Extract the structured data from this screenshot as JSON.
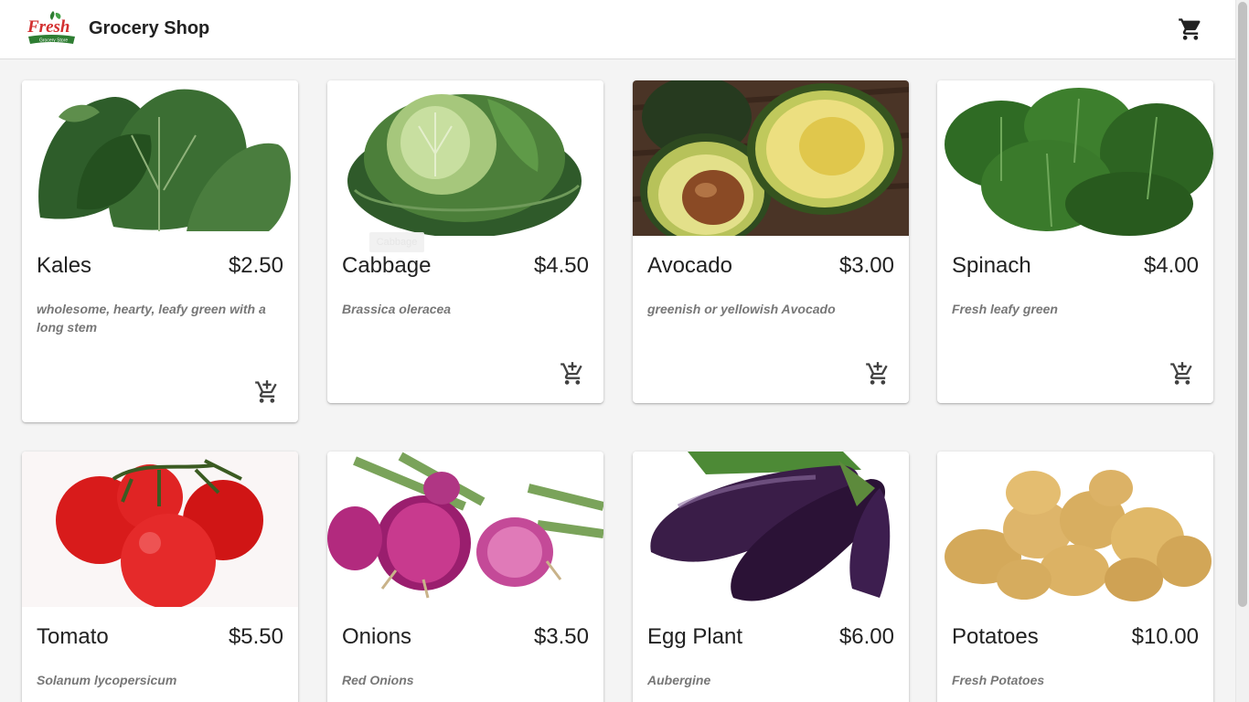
{
  "header": {
    "logo_text": "Fresh",
    "logo_subtext": "Grocery Store",
    "title": "Grocery Shop",
    "cart_icon": "cart-icon"
  },
  "tooltip": {
    "text": "Cabbage"
  },
  "products": [
    {
      "name": "Kales",
      "price": "$2.50",
      "description": "wholesome, hearty, leafy green with a long stem"
    },
    {
      "name": "Cabbage",
      "price": "$4.50",
      "description": "Brassica oleracea"
    },
    {
      "name": "Avocado",
      "price": "$3.00",
      "description": "greenish or yellowish Avocado"
    },
    {
      "name": "Spinach",
      "price": "$4.00",
      "description": "Fresh leafy green"
    },
    {
      "name": "Tomato",
      "price": "$5.50",
      "description": "Solanum lycopersicum"
    },
    {
      "name": "Onions",
      "price": "$3.50",
      "description": "Red Onions"
    },
    {
      "name": "Egg Plant",
      "price": "$6.00",
      "description": "Aubergine"
    },
    {
      "name": "Potatoes",
      "price": "$10.00",
      "description": "Fresh Potatoes"
    }
  ],
  "colors": {
    "brand_red": "#d32f2f",
    "brand_green": "#2e7d32",
    "text": "#212121",
    "muted": "#777777"
  }
}
